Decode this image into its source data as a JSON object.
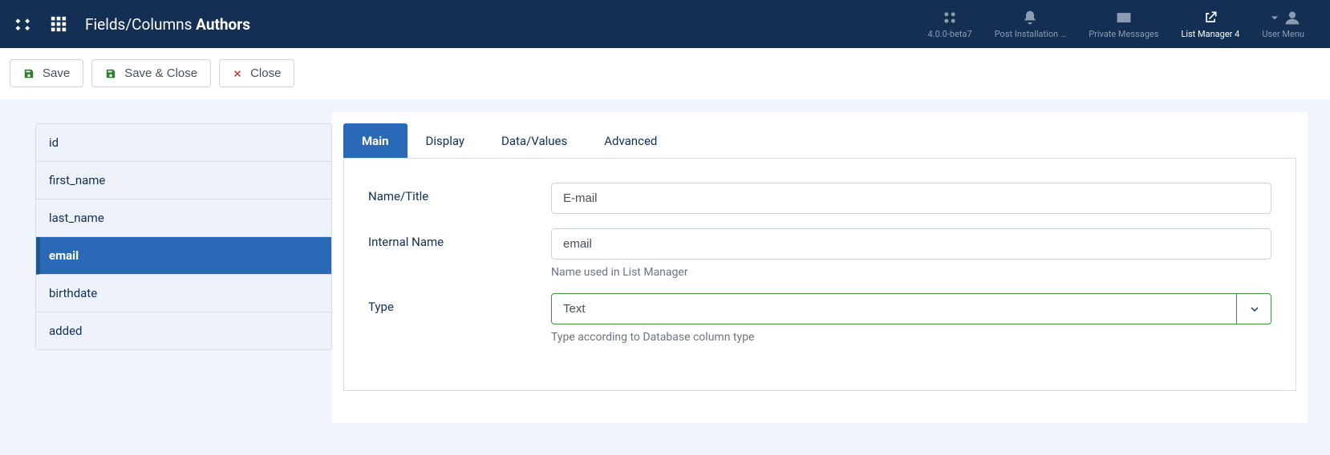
{
  "header": {
    "title_prefix": "Fields/Columns ",
    "title_bold": "Authors"
  },
  "topbar_items": [
    {
      "key": "joomla",
      "label": "4.0.0-beta7",
      "active": false
    },
    {
      "key": "postinstall",
      "label": "Post Installation …",
      "active": false
    },
    {
      "key": "privatemsg",
      "label": "Private Messages",
      "active": false
    },
    {
      "key": "listmanager",
      "label": "List Manager 4",
      "active": true
    },
    {
      "key": "usermenu",
      "label": "User Menu",
      "active": false
    }
  ],
  "toolbar": {
    "save": "Save",
    "save_close": "Save & Close",
    "close": "Close"
  },
  "sidebar": {
    "items": [
      {
        "label": "id",
        "active": false
      },
      {
        "label": "first_name",
        "active": false
      },
      {
        "label": "last_name",
        "active": false
      },
      {
        "label": "email",
        "active": true
      },
      {
        "label": "birthdate",
        "active": false
      },
      {
        "label": "added",
        "active": false
      }
    ]
  },
  "tabs": [
    {
      "label": "Main",
      "active": true
    },
    {
      "label": "Display",
      "active": false
    },
    {
      "label": "Data/Values",
      "active": false
    },
    {
      "label": "Advanced",
      "active": false
    }
  ],
  "form": {
    "name_title": {
      "label": "Name/Title",
      "value": "E-mail"
    },
    "internal_name": {
      "label": "Internal Name",
      "value": "email",
      "help": "Name used in List Manager"
    },
    "type": {
      "label": "Type",
      "value": "Text",
      "help": "Type according to Database column type"
    }
  }
}
